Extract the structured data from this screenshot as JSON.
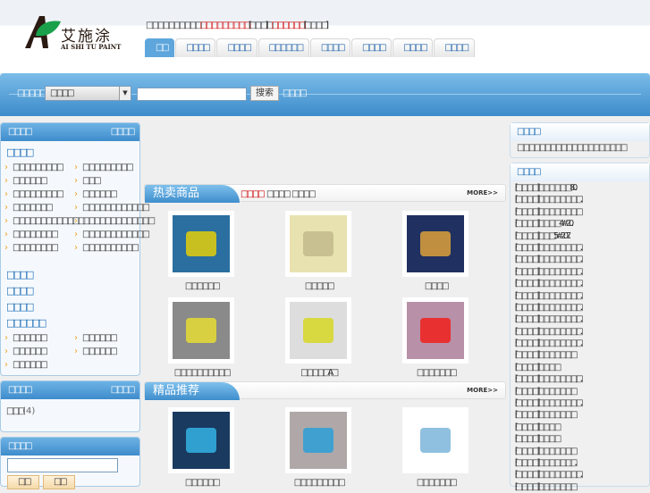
{
  "logo": {
    "cn": "艾施涂",
    "en": "AI SHI TU PAINT"
  },
  "top_text": {
    "welcome": "□□□□□□□□□□",
    "red1": "□□□□□□□□□",
    "b1": "[□□□]",
    "mid": "□",
    "red2": "□□□□□□",
    "b2": "[□□□□]"
  },
  "nav": [
    "□□",
    "□□□□",
    "□□□□",
    "□□□□□□",
    "□□□□",
    "□□□□",
    "□□□□",
    "□□□□"
  ],
  "search": {
    "label": "□□□□□",
    "select_value": "□□□□",
    "button": "搜索",
    "advanced": "□□□□"
  },
  "left_box": {
    "title": "□□□□",
    "more": "□□□□",
    "cat1": "□□□□",
    "items1": [
      "□□□□□□□□□",
      "□□□□□□□□□",
      "□□□□□□",
      "□□□",
      "□□□□□□□□□",
      "□□□□□□",
      "□□□□□□□",
      "□□□□□□□□□□□□",
      "□□□□□□□□□□□□□",
      "□□□□□□□□□□□□□",
      "□□□□□□□□",
      "□□□□□□□□□□□□",
      "□□□□□□□□",
      "□□□□□□□□□□"
    ],
    "cat2": "□□□□",
    "cat3": "□□□□",
    "cat4": "□□□□",
    "cat5": "□□□□□□",
    "items2": [
      "□□□□□□",
      "□□□□□□",
      "□□□□□□",
      "□□□□□□",
      "□□□□□□"
    ]
  },
  "brand_box": {
    "title": "□□□□",
    "more": "□□□□",
    "item": "□□□",
    "count": "(4)"
  },
  "login_box": {
    "title": "□□□□",
    "btn1": "□□",
    "btn2": "□□"
  },
  "hot": {
    "title": "热卖商品",
    "tabs": [
      "□□□□",
      "□□□□",
      "□□□□"
    ],
    "more": "MORE>>",
    "products": [
      "□□□□□□",
      "□□□□□",
      "□□□□",
      "□□□□□□□□□□",
      "□□□□□A□",
      "□□□□□□□"
    ]
  },
  "rec": {
    "title": "精品推荐",
    "more": "MORE>>",
    "products": [
      "□□□□□□",
      "□□□□□□□□□",
      "□□□□□□□"
    ]
  },
  "notice": {
    "title": "□□□□",
    "text": "□□□□□□□□□□□□□□□□□□□□"
  },
  "news": {
    "title": "□□□□",
    "items": [
      "·[□□□□] □□□□□□80...",
      "·[□□□□] □□□□□□□□...",
      "·[□□□□] □□□□□□□□",
      "·[□□□□] □□□□4#20...",
      "·[□□□□] □□□5#207...",
      "·[□□□□] □□□□□□□□...",
      "·[□□□□] □□□□□□□□...",
      "·[□□□□] □□□□□□□□...",
      "·[□□□□] □□□□□□□□...",
      "·[□□□□] □□□□□□□□...",
      "·[□□□□] □□□□□□□□...",
      "·[□□□□] □□□□□□□□...",
      "·[□□□□] □□□□□□□□...",
      "·[□□□□] □□□□□□□□...",
      "·[□□□□] □□□□□□□",
      "·[□□□□] □□□□",
      "·[□□□□] □□□□□□□□...",
      "·[□□□□] □□□□□□□",
      "·[□□□□] □□□□□□□□...",
      "·[□□□□] □□□□□□□",
      "·[□□□□] □□□□",
      "·[□□□□] □□□□",
      "·[□□□□] □□□□□□□",
      "·[□□□□] □□□□□□ □...",
      "·[□□□□] □□□□□□□□...",
      "·[□□□□] □□□□□□□"
    ]
  }
}
